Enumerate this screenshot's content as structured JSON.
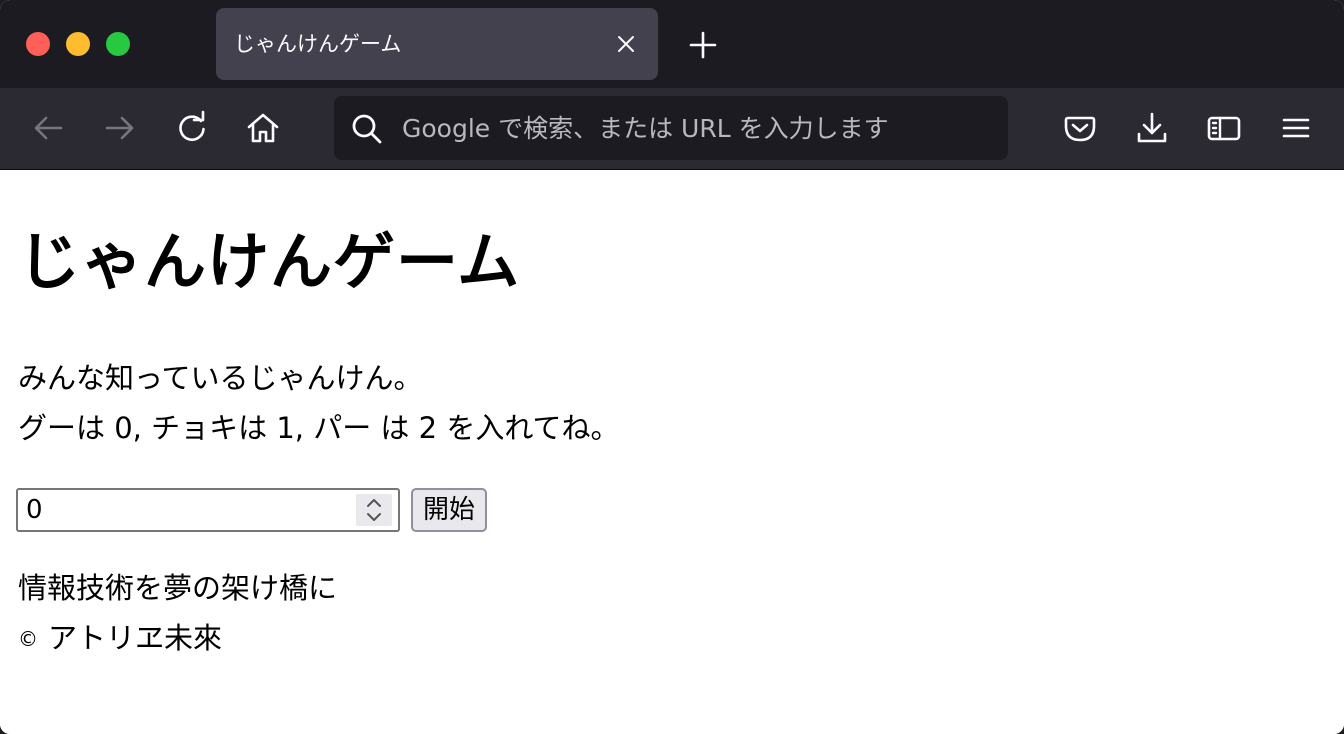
{
  "browser": {
    "tab": {
      "title": "じゃんけんゲーム"
    },
    "urlbar": {
      "placeholder": "Google で検索、または URL を入力します"
    },
    "toolbar_icons": [
      "back-arrow-icon",
      "forward-arrow-icon",
      "reload-icon",
      "home-icon",
      "pocket-icon",
      "download-icon",
      "sidebar-icon",
      "menu-icon"
    ]
  },
  "page": {
    "title": "じゃんけんゲーム",
    "description_line1": "みんな知っているじゃんけん。",
    "description_line2": "グーは 0, チョキは 1, パー は 2 を入れてね。",
    "input_value": "0",
    "start_button": "開始",
    "footer_tagline": "情報技術を夢の架け橋に",
    "copyright_symbol": "©",
    "copyright_owner": "アトリヱ未來"
  },
  "colors": {
    "chrome_dark": "#1c1b22",
    "toolbar": "#2b2a33",
    "tab_selected": "#42414d",
    "traffic_close": "#fe5f57",
    "traffic_min": "#febc2e",
    "traffic_max": "#28c840"
  }
}
